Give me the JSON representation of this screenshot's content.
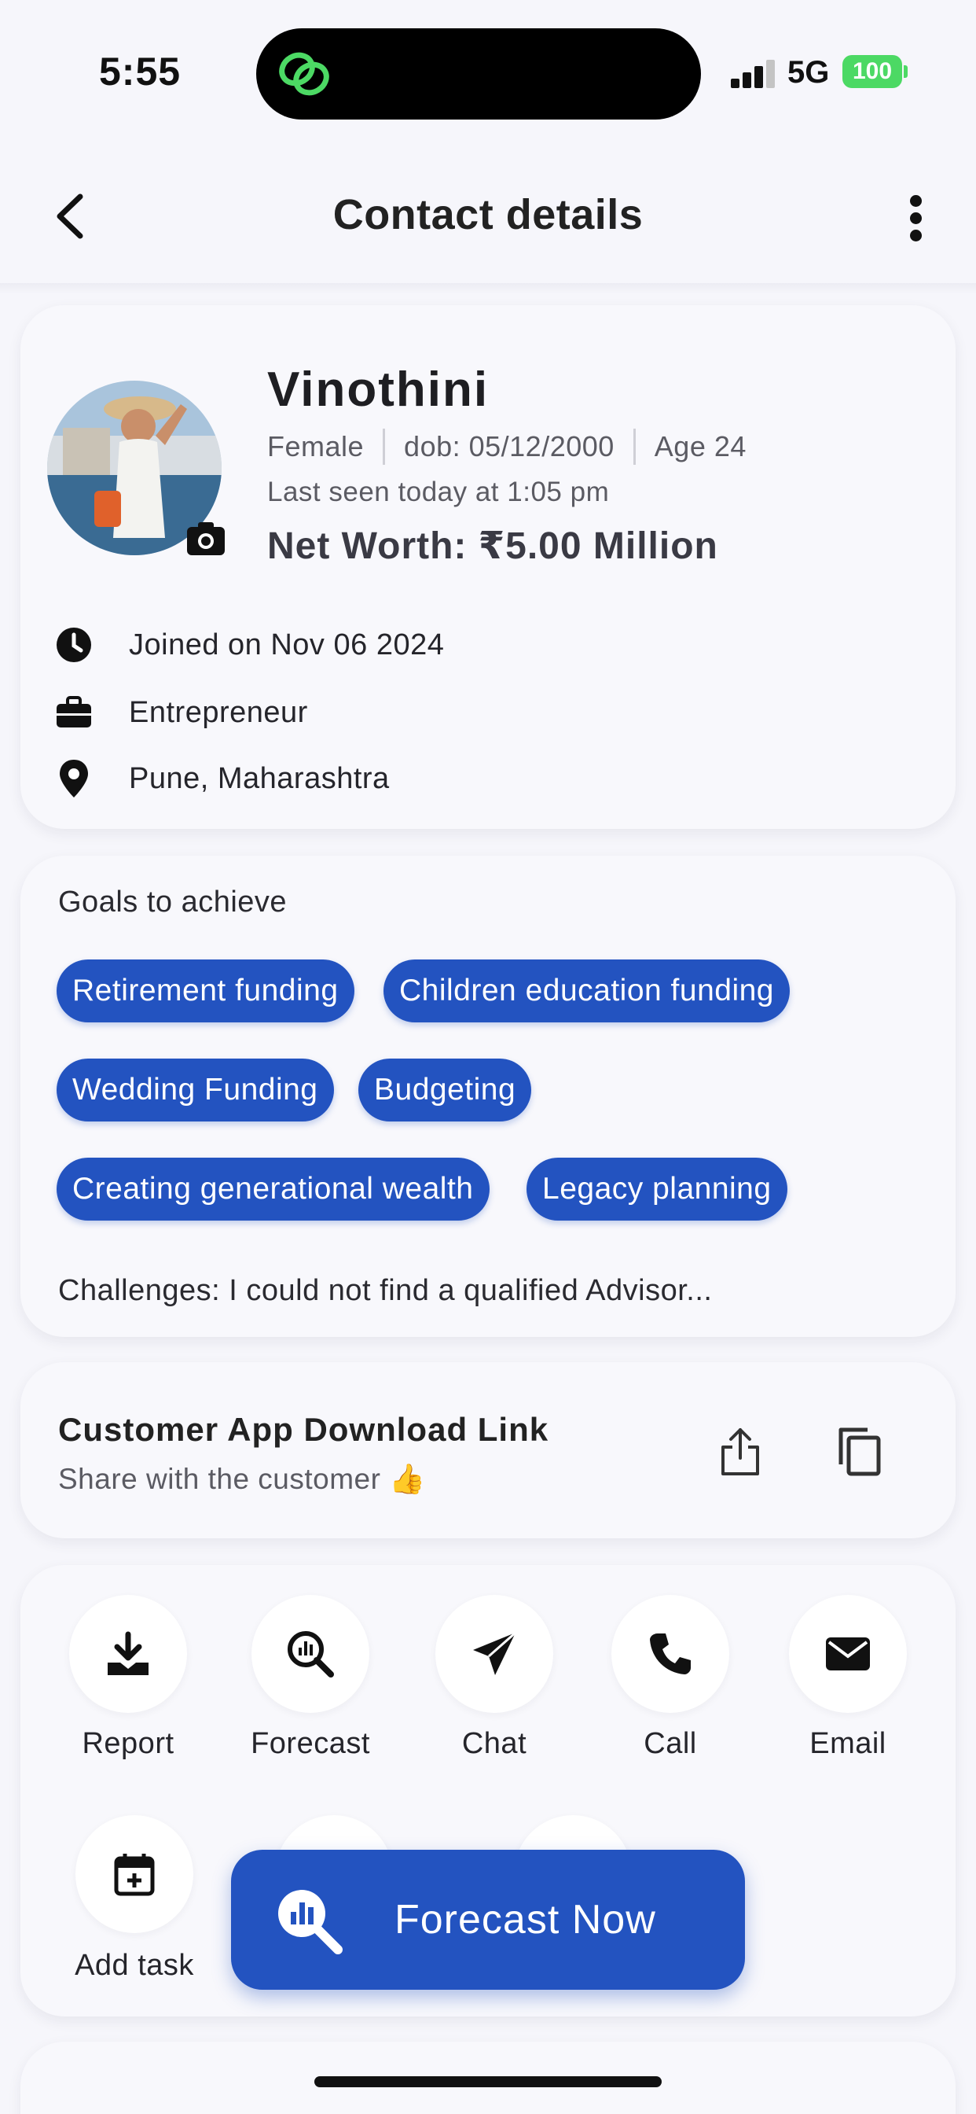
{
  "status_bar": {
    "time": "5:55",
    "network": "5G",
    "battery": "100"
  },
  "header": {
    "title": "Contact details"
  },
  "profile": {
    "name": "Vinothini",
    "gender": "Female",
    "dob": "dob: 05/12/2000",
    "age": "Age 24",
    "last_seen": "Last seen today at 1:05 pm",
    "net_worth": "Net Worth: ₹5.00 Million",
    "joined": "Joined on Nov 06 2024",
    "occupation": "Entrepreneur",
    "location": "Pune, Maharashtra"
  },
  "goals": {
    "label": "Goals to achieve",
    "chips": [
      "Retirement funding",
      "Children education funding",
      "Wedding Funding",
      "Budgeting",
      "Creating generational wealth",
      "Legacy planning"
    ],
    "challenges": "Challenges: I could not find a qualified Advisor..."
  },
  "download": {
    "title": "Customer App Download Link",
    "subtitle": "Share with the customer 👍"
  },
  "actions": [
    {
      "label": "Report",
      "icon": "download-icon"
    },
    {
      "label": "Forecast",
      "icon": "forecast-search-icon"
    },
    {
      "label": "Chat",
      "icon": "send-icon"
    },
    {
      "label": "Call",
      "icon": "phone-icon"
    },
    {
      "label": "Email",
      "icon": "envelope-icon"
    },
    {
      "label": "Add task",
      "icon": "calendar-plus-icon"
    }
  ],
  "fab": {
    "label": "Forecast Now"
  },
  "colors": {
    "primary": "#2353c0",
    "background": "#f6f6fb",
    "battery": "#4cd964"
  }
}
